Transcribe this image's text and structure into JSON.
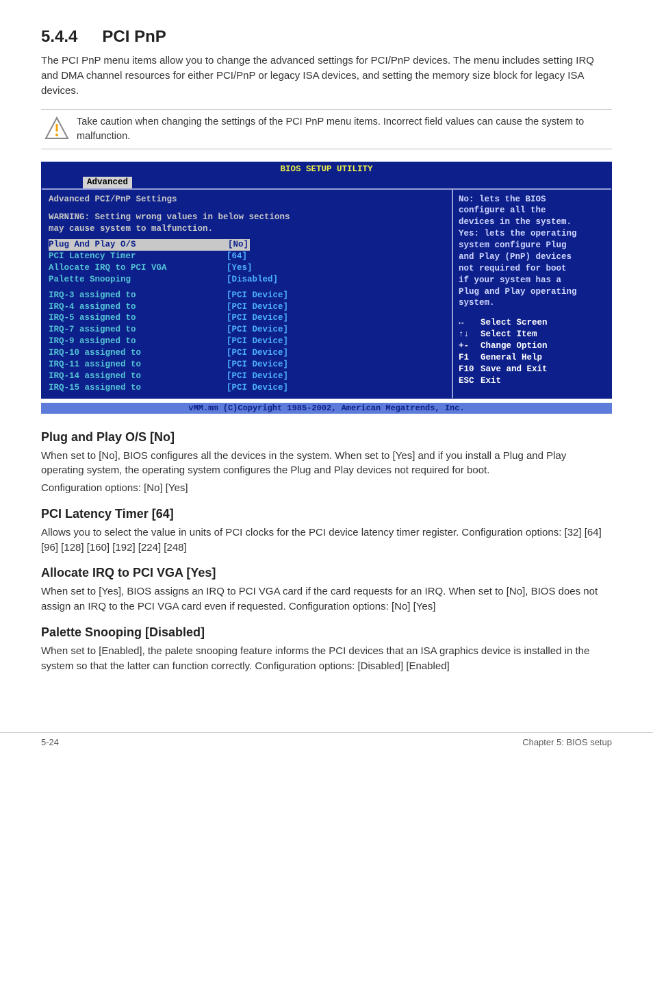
{
  "section": {
    "number": "5.4.4",
    "title": "PCI PnP",
    "intro": "The PCI PnP menu items allow you to change the advanced settings for PCI/PnP devices. The menu includes setting IRQ and DMA channel resources for either PCI/PnP or legacy ISA devices, and setting the memory size block for legacy ISA devices."
  },
  "note": "Take caution when changing the settings of the PCI PnP menu items. Incorrect field values can cause the system to malfunction.",
  "bios": {
    "title": "BIOS SETUP UTILITY",
    "tab": "Advanced",
    "panel_title": "Advanced PCI/PnP Settings",
    "warning1": "WARNING: Setting wrong values in below sections",
    "warning2": "         may cause system to malfunction.",
    "rows": [
      {
        "label": "Plug And Play O/S",
        "value": "[No]",
        "sel": true
      },
      {
        "label": "PCI Latency Timer",
        "value": "[64]"
      },
      {
        "label": "Allocate IRQ to PCI VGA",
        "value": "[Yes]"
      },
      {
        "label": "Palette Snooping",
        "value": "[Disabled]"
      }
    ],
    "irq_rows": [
      {
        "label": "IRQ-3 assigned to",
        "value": "[PCI Device]"
      },
      {
        "label": "IRQ-4 assigned to",
        "value": "[PCI Device]"
      },
      {
        "label": "IRQ-5 assigned to",
        "value": "[PCI Device]"
      },
      {
        "label": "IRQ-7 assigned to",
        "value": "[PCI Device]"
      },
      {
        "label": "IRQ-9 assigned to",
        "value": "[PCI Device]"
      },
      {
        "label": "IRQ-10 assigned to",
        "value": "[PCI Device]"
      },
      {
        "label": "IRQ-11 assigned to",
        "value": "[PCI Device]"
      },
      {
        "label": "IRQ-14 assigned to",
        "value": "[PCI Device]"
      },
      {
        "label": "IRQ-15 assigned to",
        "value": "[PCI Device]"
      }
    ],
    "help": [
      "No: lets the BIOS",
      "configure all the",
      "devices in the system.",
      "Yes: lets the operating",
      "system configure Plug",
      "and Play (PnP) devices",
      "not required for boot",
      "if your system has a",
      "Plug and Play operating",
      "system."
    ],
    "keys": [
      {
        "k": "↔",
        "d": "Select Screen"
      },
      {
        "k": "↑↓",
        "d": "Select Item"
      },
      {
        "k": "+-",
        "d": "Change Option"
      },
      {
        "k": "F1",
        "d": "General Help"
      },
      {
        "k": "F10",
        "d": "Save and Exit"
      },
      {
        "k": "ESC",
        "d": "Exit"
      }
    ],
    "footer": "vMM.mm (C)Copyright 1985-2002, American Megatrends, Inc."
  },
  "subs": [
    {
      "h": "Plug and Play O/S [No]",
      "p1": "When set to [No], BIOS configures all the devices in the system. When set to [Yes] and if you install a Plug and Play operating system, the operating system configures the Plug and Play devices not required for boot.",
      "p2": "Configuration options: [No] [Yes]"
    },
    {
      "h": "PCI Latency Timer [64]",
      "p1": "Allows you to select the value in units of PCI clocks for the PCI device latency timer register. Configuration options: [32] [64] [96] [128] [160] [192] [224] [248]",
      "p2": ""
    },
    {
      "h": "Allocate IRQ to PCI VGA [Yes]",
      "p1": "When set to [Yes], BIOS assigns an IRQ to PCI VGA card if the card requests for an IRQ. When set to [No], BIOS does not assign an IRQ to the PCI VGA card even if requested. Configuration options: [No] [Yes]",
      "p2": ""
    },
    {
      "h": "Palette Snooping [Disabled]",
      "p1": "When set to [Enabled], the palete snooping feature informs the PCI devices that an ISA graphics device is installed in the system so that the latter can function correctly. Configuration options: [Disabled] [Enabled]",
      "p2": ""
    }
  ],
  "footer": {
    "left": "5-24",
    "right": "Chapter 5: BIOS setup"
  }
}
